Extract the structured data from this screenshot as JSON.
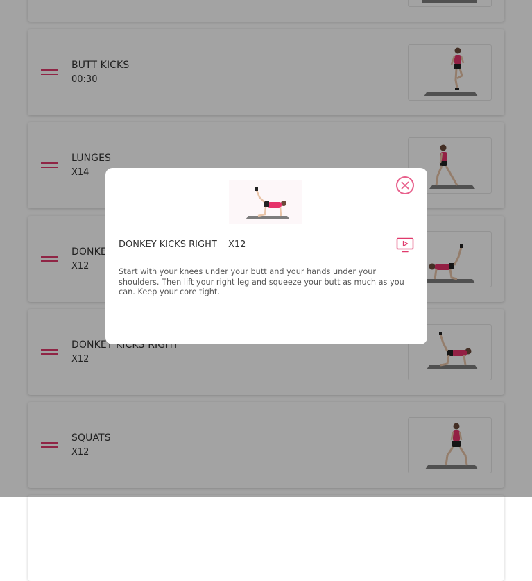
{
  "exercises": [
    {
      "name": "",
      "rep": "",
      "image": "kneel-stretch"
    },
    {
      "name": "BUTT KICKS",
      "rep": "00:30",
      "image": "butt-kicks-figure"
    },
    {
      "name": "LUNGES",
      "rep": "X14",
      "image": "lunge-figure"
    },
    {
      "name": "DONKEY KICKS LEFT",
      "rep": "X12",
      "image": "donkey-kick-figure"
    },
    {
      "name": "DONKEY KICKS RIGHT",
      "rep": "X12",
      "image": "donkey-kick-figure"
    },
    {
      "name": "SQUATS",
      "rep": "X12",
      "image": "squat-figure"
    }
  ],
  "modal": {
    "title": "DONKEY KICKS RIGHT",
    "rep": "X12",
    "description": "Start with your knees under your butt and your hands under your shoulders. Then lift your right leg and squeeze your butt as much as you can. Keep your core tight.",
    "close_icon": "close-circle-icon",
    "video_icon": "play-video-icon"
  },
  "colors": {
    "accent": "#e03a6c",
    "shirt": "#e6336b",
    "mat": "#7d7d7d",
    "overlay": "rgba(0,0,0,0.36)"
  }
}
